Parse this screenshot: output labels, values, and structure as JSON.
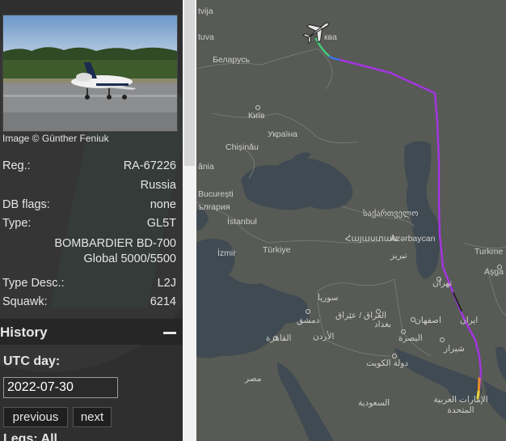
{
  "aircraft": {
    "photo_credit": "Image © Günther Feniuk",
    "reg_label": "Reg.:",
    "reg_value": "RA-67226",
    "country": "Russia",
    "dbflags_label": "DB flags:",
    "dbflags_value": "none",
    "type_label": "Type:",
    "type_value": "GL5T",
    "type_full_1": "BOMBARDIER BD-700",
    "type_full_2": "Global 5000/5500",
    "typedesc_label": "Type Desc.:",
    "typedesc_value": "L2J",
    "squawk_label": "Squawk:",
    "squawk_value": "6214"
  },
  "history": {
    "title": "History",
    "utc_label": "UTC day:",
    "date_value": "2022-07-30",
    "previous_label": "previous",
    "next_label": "next",
    "legs_label": "Legs: All"
  },
  "map": {
    "labels": {
      "latvija": "tvija",
      "lietuva": "tuva",
      "moskva": "ква",
      "belarus": "Беларусь",
      "kyiv": "Київ",
      "ukraina": "Україна",
      "chisinau": "Chișinău",
      "romania": "ânia",
      "bucuresti": "București",
      "bulgaria": "ългария",
      "istanbul": "İstanbul",
      "georgia": "საქართველო",
      "armenia": "Հայաստան",
      "azerbaycan": "Azərbaycan",
      "turkiye": "Türkiye",
      "izmir": "İzmir",
      "tabriz": "تبریز",
      "tehran": "تهران",
      "turkmenistan": "Turkme",
      "asgabat": "Aşga",
      "syria": "سوريا",
      "iraq": "العراق / عێراق",
      "damascus": "دمشق",
      "baghdad": "بغداد",
      "jordan": "الأردن",
      "isfahan": "اصفهان",
      "iran": "ایران",
      "cairo": "القاهرة",
      "basra": "البصرة",
      "kuwait": "دولة الكويت",
      "shiraz": "شیراز",
      "misr": "مصر",
      "saudi": "السعودية",
      "uae": "الإمارات العربية المتحدة"
    },
    "colors": {
      "land": "#575a55",
      "sea": "#3f4a52",
      "track": "#a335e0",
      "track_start": "#2ec4b6"
    }
  }
}
